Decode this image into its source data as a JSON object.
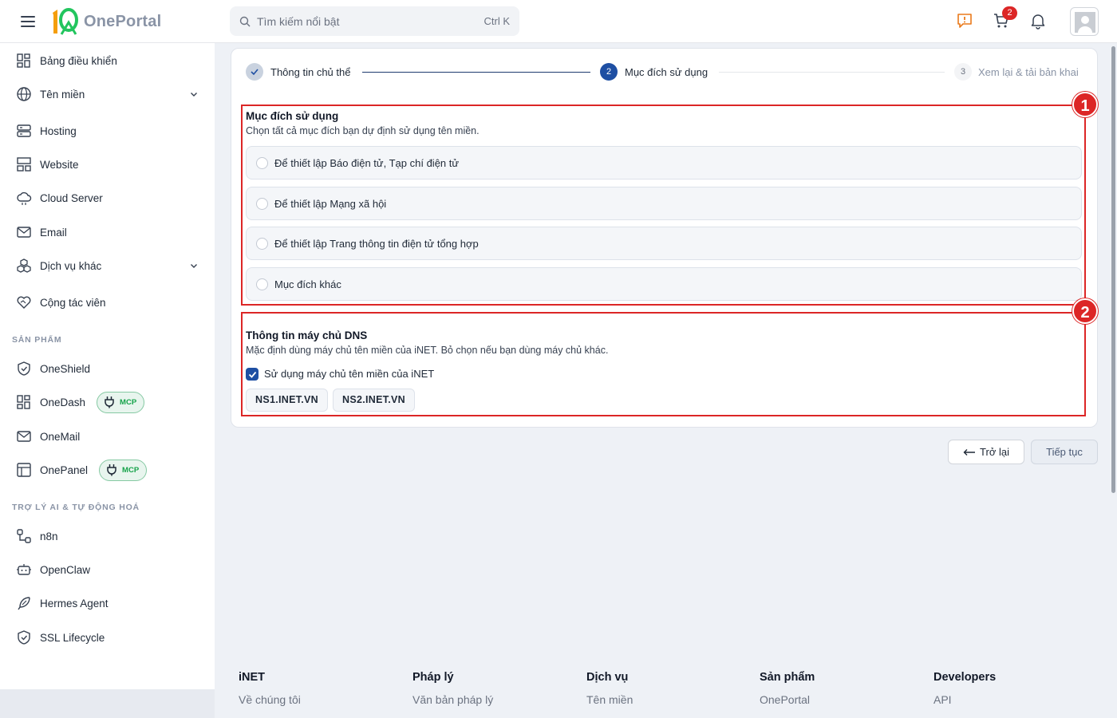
{
  "header": {
    "logo_text": "OnePortal",
    "search_placeholder": "Tìm kiếm nổi bật",
    "search_shortcut": "Ctrl K",
    "cart_count": "2"
  },
  "sidebar": {
    "items": [
      {
        "label": "Bảng điều khiển",
        "icon": "dashboard-icon"
      },
      {
        "label": "Tên miền",
        "icon": "globe-icon"
      },
      {
        "label": "Hosting",
        "icon": "server-icon"
      },
      {
        "label": "Website",
        "icon": "website-icon"
      },
      {
        "label": "Cloud Server",
        "icon": "cloud-icon"
      },
      {
        "label": "Email",
        "icon": "mail-icon"
      },
      {
        "label": "Dịch vụ khác",
        "icon": "cubes-icon"
      },
      {
        "label": "Cộng tác viên",
        "icon": "handshake-heart-icon"
      }
    ],
    "section_products": "SẢN PHẨM",
    "products": [
      {
        "label": "OneShield",
        "icon": "shield-icon"
      },
      {
        "label": "OneDash",
        "icon": "dashboard-icon",
        "badge": "MCP"
      },
      {
        "label": "OneMail",
        "icon": "mail-icon"
      },
      {
        "label": "OnePanel",
        "icon": "panel-icon",
        "badge": "MCP"
      }
    ],
    "section_ai": "TRỢ LÝ AI & TỰ ĐỘNG HOÁ",
    "ai_items": [
      {
        "label": "n8n",
        "icon": "workflow-icon"
      },
      {
        "label": "OpenClaw",
        "icon": "robot-icon"
      },
      {
        "label": "Hermes Agent",
        "icon": "feather-icon"
      },
      {
        "label": "SSL Lifecycle",
        "icon": "shield-check-icon"
      }
    ]
  },
  "stepper": {
    "steps": [
      {
        "number": "1",
        "label": "Thông tin chủ thể",
        "state": "done"
      },
      {
        "number": "2",
        "label": "Mục đích sử dụng",
        "state": "active"
      },
      {
        "number": "3",
        "label": "Xem lại & tải bản khai",
        "state": "pending"
      }
    ]
  },
  "purpose": {
    "marker": "1",
    "title": "Mục đích sử dụng",
    "description": "Chọn tất cả mục đích bạn dự định sử dụng tên miền.",
    "options": [
      "Để thiết lập Báo điện tử, Tạp chí điện tử",
      "Để thiết lập Mạng xã hội",
      "Để thiết lập Trang thông tin điện tử tổng hợp",
      "Mục đích khác"
    ]
  },
  "dns": {
    "marker": "2",
    "title": "Thông tin máy chủ DNS",
    "description": "Mặc định dùng máy chủ tên miền của iNET. Bỏ chọn nếu bạn dùng máy chủ khác.",
    "checkbox_label": "Sử dụng máy chủ tên miền của iNET",
    "checked": true,
    "servers": [
      "NS1.INET.VN",
      "NS2.INET.VN"
    ]
  },
  "actions": {
    "back": "Trở lại",
    "next": "Tiếp tục"
  },
  "footer": {
    "columns": [
      {
        "title": "iNET",
        "link": "Về chúng tôi"
      },
      {
        "title": "Pháp lý",
        "link": "Văn bản pháp lý"
      },
      {
        "title": "Dịch vụ",
        "link": "Tên miền"
      },
      {
        "title": "Sản phẩm",
        "link": "OnePortal"
      },
      {
        "title": "Developers",
        "link": "API"
      }
    ]
  },
  "colors": {
    "primary": "#1e4fa3",
    "annotation_red": "#dc2626",
    "mcp_green": "#16a34a"
  }
}
